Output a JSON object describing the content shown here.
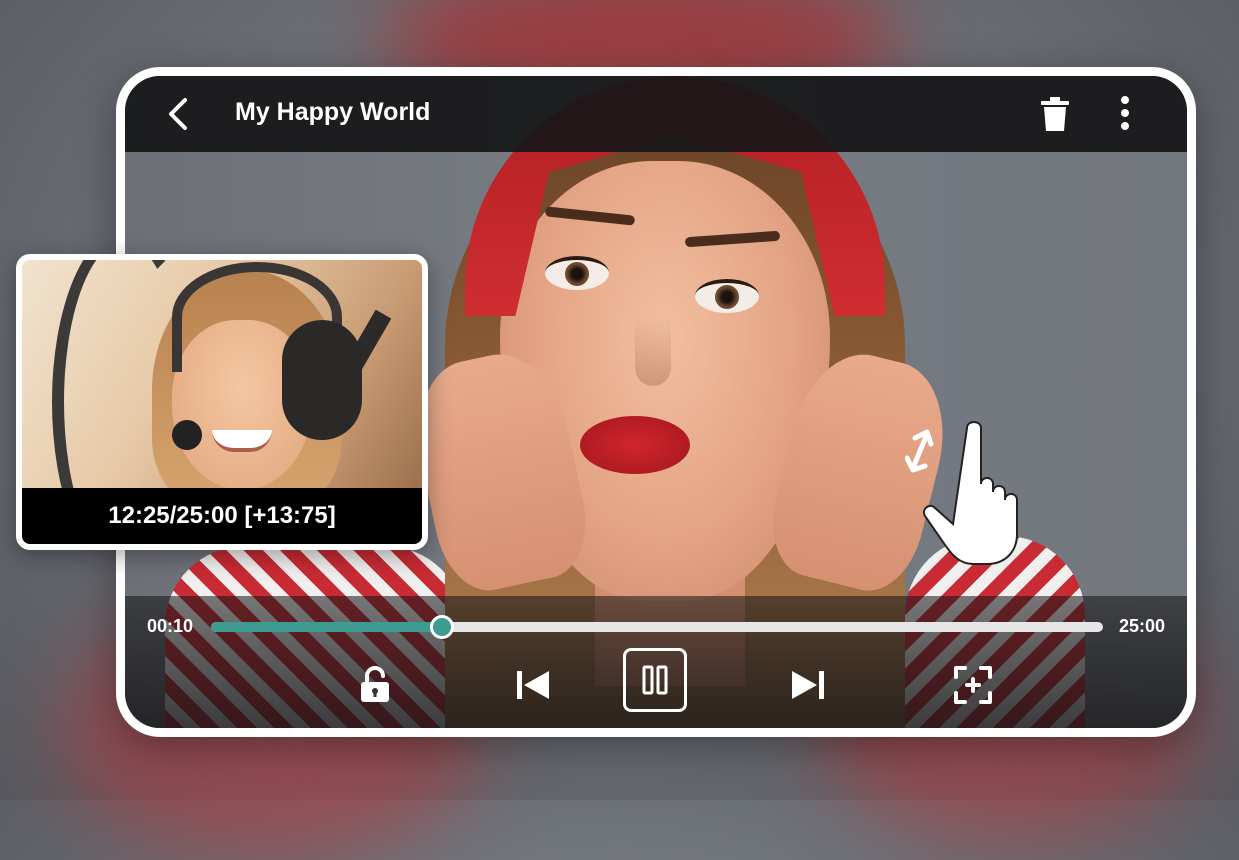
{
  "header": {
    "title": "My Happy World",
    "back_icon": "chevron-left-icon",
    "delete_icon": "trash-icon",
    "more_icon": "more-vertical-icon"
  },
  "playback": {
    "current_time": "00:10",
    "total_time": "25:00",
    "progress_fraction": 0.26,
    "accent_color": "#3e9b91"
  },
  "controls": {
    "lock_icon": "unlock-icon",
    "prev_icon": "skip-previous-icon",
    "pause_icon": "pause-icon",
    "next_icon": "skip-next-icon",
    "fit_icon": "fit-screen-icon"
  },
  "preview": {
    "seek_caption": "12:25/25:00 [+13:75]"
  },
  "gesture_hint": {
    "icon": "hand-swipe-vertical-icon"
  }
}
